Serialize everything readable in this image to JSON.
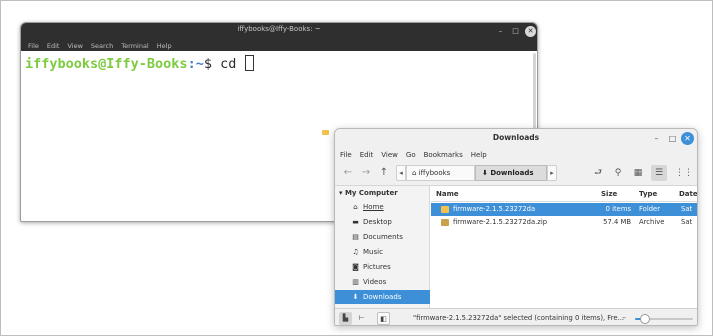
{
  "terminal": {
    "title": "iffybooks@Iffy-Books: ~",
    "menu": [
      "File",
      "Edit",
      "View",
      "Search",
      "Terminal",
      "Help"
    ],
    "prompt_user": "iffybooks@Iffy-Books",
    "prompt_path": ":~",
    "prompt_tail": "$ cd ",
    "controls": {
      "minimize": "–",
      "maximize": "□",
      "close": "✕"
    }
  },
  "files": {
    "title": "Downloads",
    "controls": {
      "minimize": "–",
      "maximize": "□",
      "close": "✕"
    },
    "menu": [
      "File",
      "Edit",
      "View",
      "Go",
      "Bookmarks",
      "Help"
    ],
    "toolbar": {
      "back": "←",
      "forward": "→",
      "up": "↑",
      "crumb_left": "◂",
      "crumb_home": "iffybooks",
      "crumb_home_icon": "⌂",
      "crumb_current": "Downloads",
      "crumb_current_icon": "⬇",
      "crumb_right": "▸",
      "new_folder": "⮐",
      "search": "⚲",
      "icon_view": "▦",
      "list_view": "☰",
      "compact_view": "⋮⋮"
    },
    "sidebar": {
      "header": "My Computer",
      "header_icon": "▾",
      "items": [
        {
          "label": "Home",
          "icon": "⌂"
        },
        {
          "label": "Desktop",
          "icon": "▬"
        },
        {
          "label": "Documents",
          "icon": "▤"
        },
        {
          "label": "Music",
          "icon": "♫"
        },
        {
          "label": "Pictures",
          "icon": "◙"
        },
        {
          "label": "Videos",
          "icon": "▥"
        },
        {
          "label": "Downloads",
          "icon": "⬇"
        }
      ]
    },
    "columns": {
      "name": "Name",
      "size": "Size",
      "type": "Type",
      "date": "Date"
    },
    "rows": [
      {
        "name": "firmware-2.1.5.23272da",
        "size": "0 items",
        "type": "Folder",
        "date": "Sat",
        "color": "#f2c14e"
      },
      {
        "name": "firmware-2.1.5.23272da.zip",
        "size": "57.4 MB",
        "type": "Archive",
        "date": "Sat",
        "color": "#c9a24a"
      }
    ],
    "status": {
      "text": "\"firmware-2.1.5.23272da\" selected (containing 0 items), Fre...",
      "places_icon": "▙",
      "tree_icon": "⊢",
      "toggle_icon": "◧",
      "zoom_minus": "–",
      "zoom_level": 0.18
    }
  },
  "colors": {
    "accent": "#3d8fd8",
    "prompt_user": "#7dcb3f",
    "prompt_path": "#4a7fc6",
    "folder": "#f2c14e"
  }
}
